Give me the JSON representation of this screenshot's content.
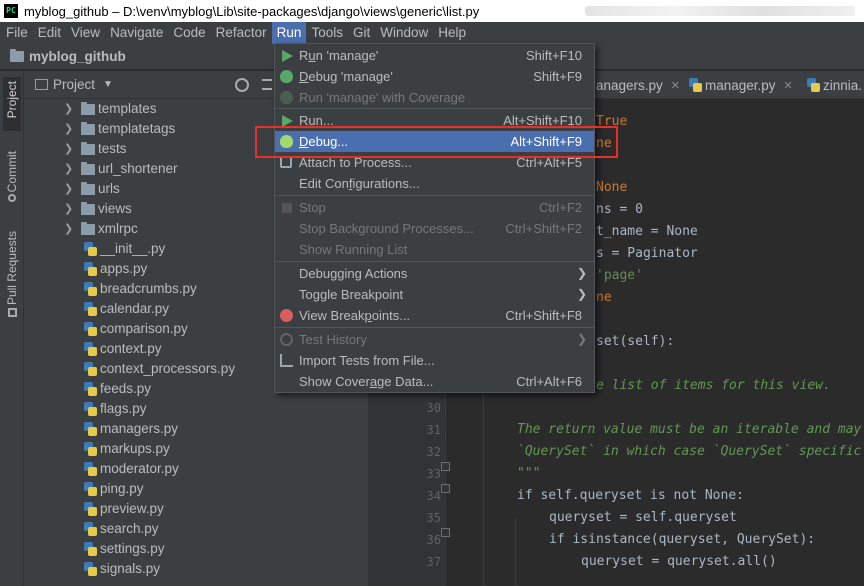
{
  "window": {
    "title": "myblog_github – D:\\venv\\myblog\\Lib\\site-packages\\django\\views\\generic\\list.py",
    "app_icon_text": "PC"
  },
  "menubar": [
    "File",
    "Edit",
    "View",
    "Navigate",
    "Code",
    "Refactor",
    "Run",
    "Tools",
    "Git",
    "Window",
    "Help"
  ],
  "menubar_active": "Run",
  "navbar": {
    "project": "myblog_github"
  },
  "left_tabs": [
    "Project",
    "Commit",
    "Pull Requests"
  ],
  "project_panel": {
    "title": "Project",
    "folders": [
      "templates",
      "templatetags",
      "tests",
      "url_shortener",
      "urls",
      "views",
      "xmlrpc"
    ],
    "files": [
      "__init__.py",
      "apps.py",
      "breadcrumbs.py",
      "calendar.py",
      "comparison.py",
      "context.py",
      "context_processors.py",
      "feeds.py",
      "flags.py",
      "managers.py",
      "markups.py",
      "moderator.py",
      "ping.py",
      "preview.py",
      "search.py",
      "settings.py",
      "signals.py"
    ]
  },
  "editor_tabs": [
    "anagers.py",
    "manager.py",
    "zinnia."
  ],
  "editor": {
    "line_numbers": [
      "30",
      "31",
      "32",
      "33",
      "34",
      "35",
      "36",
      "37"
    ],
    "visible_fragments": [
      "True",
      "ne",
      "None",
      "ns = 0",
      "t_name = None",
      "s = Paginator",
      "'page'",
      "ne",
      "set(self):",
      "e list of items for this view."
    ],
    "lines": [
      "",
      "The return value must be an iterable and may",
      "`QuerySet` in which case `QuerySet` specific",
      "\"\"\"",
      "if self.queryset is not None:",
      "queryset = self.queryset",
      "if isinstance(queryset, QuerySet):",
      "queryset = queryset.all()"
    ]
  },
  "run_menu": {
    "items": [
      {
        "label": "Run 'manage'",
        "shortcut": "Shift+F10",
        "disabled": false
      },
      {
        "label": "Debug 'manage'",
        "shortcut": "Shift+F9",
        "disabled": false
      },
      {
        "label": "Run 'manage' with Coverage",
        "shortcut": "",
        "disabled": true
      },
      {
        "label": "Run...",
        "shortcut": "Alt+Shift+F10",
        "disabled": false
      },
      {
        "label": "Debug...",
        "shortcut": "Alt+Shift+F9",
        "disabled": false,
        "highlighted": true
      },
      {
        "label": "Attach to Process...",
        "shortcut": "Ctrl+Alt+F5",
        "disabled": false
      },
      {
        "label": "Edit Configurations...",
        "shortcut": "",
        "disabled": false
      },
      {
        "label": "Stop",
        "shortcut": "Ctrl+F2",
        "disabled": true
      },
      {
        "label": "Stop Background Processes...",
        "shortcut": "Ctrl+Shift+F2",
        "disabled": true
      },
      {
        "label": "Show Running List",
        "shortcut": "",
        "disabled": true
      },
      {
        "label": "Debugging Actions",
        "shortcut": "",
        "disabled": false,
        "submenu": true
      },
      {
        "label": "Toggle Breakpoint",
        "shortcut": "",
        "disabled": false,
        "submenu": true
      },
      {
        "label": "View Breakpoints...",
        "shortcut": "Ctrl+Shift+F8",
        "disabled": false
      },
      {
        "label": "Test History",
        "shortcut": "",
        "disabled": true,
        "submenu": true
      },
      {
        "label": "Import Tests from File...",
        "shortcut": "",
        "disabled": false
      },
      {
        "label": "Show Coverage Data...",
        "shortcut": "Ctrl+Alt+F6",
        "disabled": false
      }
    ]
  },
  "colors": {
    "accent": "#4b6eaf",
    "annotation_box": "#e8302a",
    "panel_bg": "#3c3f41",
    "editor_bg": "#2b2b2b"
  }
}
